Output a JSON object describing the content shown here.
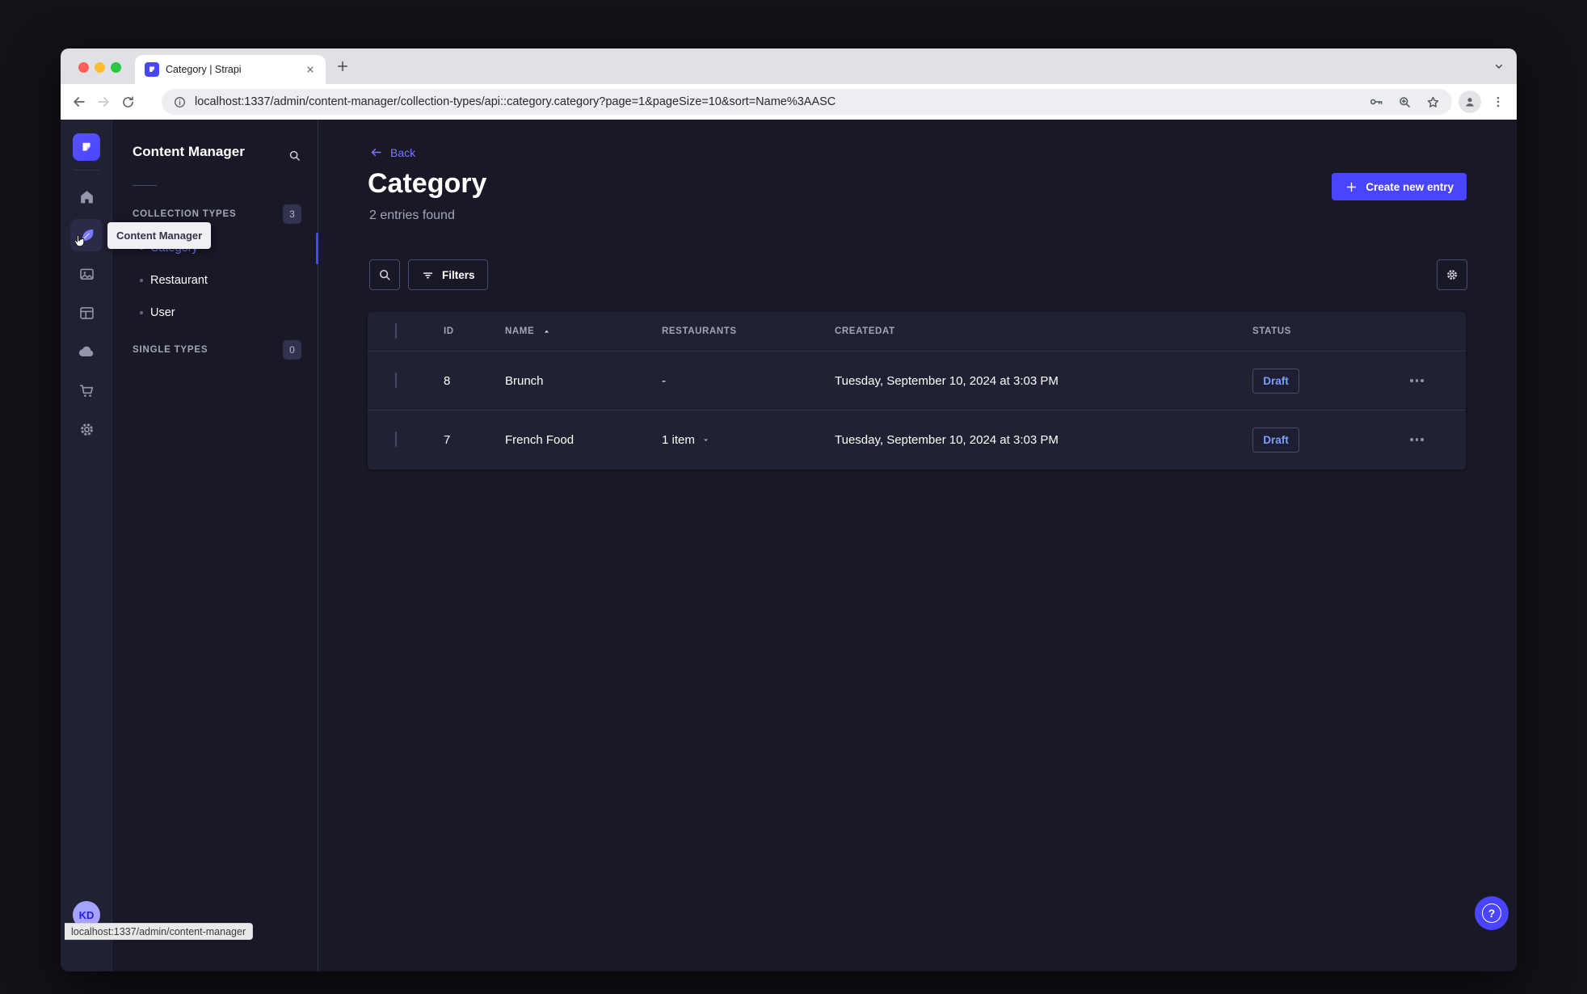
{
  "browser": {
    "tab_title": "Category | Strapi",
    "url": "localhost:1337/admin/content-manager/collection-types/api::category.category?page=1&pageSize=10&sort=Name%3AASC",
    "status_bar": "localhost:1337/admin/content-manager"
  },
  "rail": {
    "items": [
      "home",
      "content-manager",
      "media-library",
      "content-type-builder",
      "deploy",
      "marketplace",
      "settings"
    ],
    "active_item": "content-manager",
    "avatar_initials": "KD"
  },
  "subnav": {
    "title": "Content Manager",
    "tooltip": "Content Manager",
    "sections": [
      {
        "label": "COLLECTION TYPES",
        "badge": "3",
        "items": [
          {
            "label": "Category"
          },
          {
            "label": "Restaurant"
          },
          {
            "label": "User"
          }
        ]
      },
      {
        "label": "SINGLE TYPES",
        "badge": "0",
        "items": []
      }
    ]
  },
  "main": {
    "back_label": "Back",
    "title": "Category",
    "subtitle": "2 entries found",
    "create_button_label": "Create new entry",
    "filters_button_label": "Filters",
    "help_label": "?",
    "table": {
      "headers": [
        "ID",
        "NAME",
        "RESTAURANTS",
        "CREATEDAT",
        "STATUS"
      ],
      "rows": [
        {
          "id": "8",
          "name": "Brunch",
          "restaurants": "-",
          "createdat": "Tuesday, September 10, 2024 at 3:03 PM",
          "status": "Draft"
        },
        {
          "id": "7",
          "name": "French Food",
          "restaurants": "1 item",
          "createdat": "Tuesday, September 10, 2024 at 3:03 PM",
          "status": "Draft"
        }
      ]
    }
  },
  "colors": {
    "accent": "#4945ff",
    "accent_light": "#7b79ff",
    "draft_text": "#7b9eff",
    "traffic_red": "#ff5f57",
    "traffic_yellow": "#febc2e",
    "traffic_green": "#28c840"
  }
}
